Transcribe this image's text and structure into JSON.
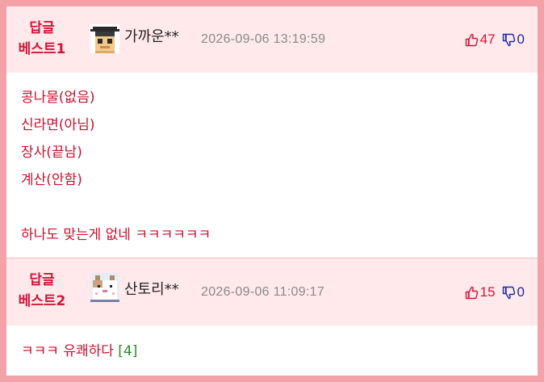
{
  "comments": [
    {
      "badge_line1": "답글",
      "badge_line2": "베스트1",
      "avatar_icon": "graduate-pixel-avatar",
      "username": "가까운**",
      "date": "2026-09-06 13:19:59",
      "upvotes": "47",
      "downvotes": "0",
      "lines": [
        "콩나물(없음)",
        "신라면(아님)",
        "장사(끝남)",
        "계산(안함)",
        "",
        "하나도 맞는게 없네 ㅋㅋㅋㅋㅋㅋ"
      ]
    },
    {
      "badge_line1": "답글",
      "badge_line2": "베스트2",
      "avatar_icon": "hamster-pixel-avatar",
      "username": "산토리**",
      "date": "2026-09-06 11:09:17",
      "upvotes": "15",
      "downvotes": "0",
      "text": "ㅋㅋㅋ 유쾌하다",
      "reply_count": "[4]"
    }
  ],
  "colors": {
    "border": "#f3a3a8",
    "header_bg": "#ffe9ea",
    "accent_red": "#d2143a",
    "body_text": "#c8102e",
    "down_blue": "#1a2aa8",
    "reply_green": "#2a8a2a"
  }
}
